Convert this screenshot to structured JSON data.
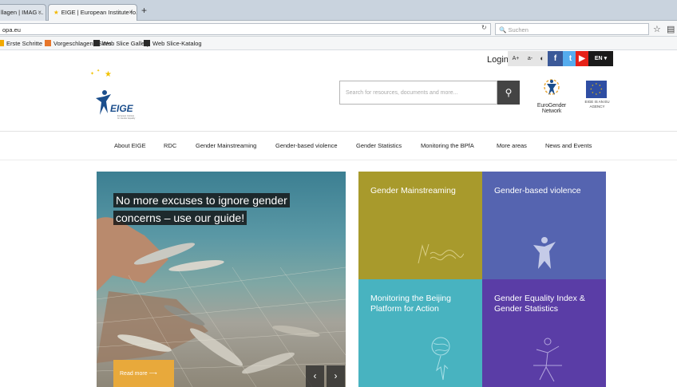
{
  "browser": {
    "tabs": [
      {
        "title": "llagen | IMAG ..."
      },
      {
        "title": "EIGE | European Institute fo..."
      }
    ],
    "url": "opa.eu",
    "search_placeholder": "Suchen",
    "bookmarks": [
      {
        "label": "Erste Schritte"
      },
      {
        "label": "Vorgeschlagene Sites"
      },
      {
        "label": "Web Slice Gallery"
      },
      {
        "label": "Web Slice-Katalog"
      }
    ]
  },
  "utility": {
    "login": "Login",
    "font_increase": "A+",
    "font_decrease": "a-",
    "contrast": "◐",
    "language": "EN"
  },
  "header": {
    "logo_text": "EIGE",
    "logo_subtitle": "European Institute for Gender Equality",
    "search_placeholder": "Search for resources, documents and more...",
    "eurogender_label": "EuroGender Network",
    "eu_agency_label": "EIGE IS AN EU AGENCY"
  },
  "nav": {
    "items": [
      {
        "label": "About EIGE"
      },
      {
        "label": "RDC"
      },
      {
        "label": "Gender Mainstreaming"
      },
      {
        "label": "Gender-based violence"
      },
      {
        "label": "Gender Statistics"
      },
      {
        "label": "Monitoring the BPfA"
      },
      {
        "label": "More areas"
      },
      {
        "label": "News and Events"
      }
    ]
  },
  "hero": {
    "headline": "No more excuses to ignore gender concerns – use our guide!",
    "read_more": "Read more ⟶",
    "prev": "‹",
    "next": "›"
  },
  "tiles": [
    {
      "title": "Gender Mainstreaming",
      "color": "#a89a2c"
    },
    {
      "title": "Gender-based violence",
      "color": "#5564b0"
    },
    {
      "title": "Monitoring the Beijing Platform for Action",
      "color": "#48b3c0"
    },
    {
      "title": "Gender Equality Index & Gender Statistics",
      "color": "#5a3da6"
    }
  ]
}
